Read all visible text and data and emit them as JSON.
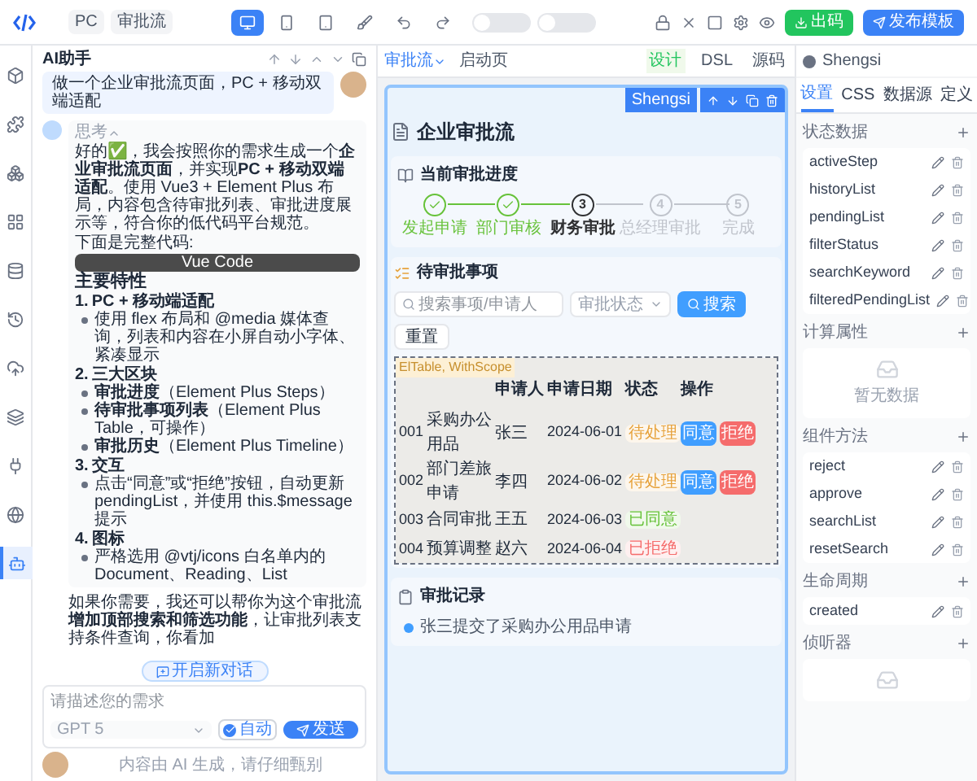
{
  "topbar": {
    "breadcrumbs": [
      "PC",
      "审批流"
    ],
    "toolbar": [
      {
        "selected": true
      },
      {
        "selected": false
      },
      {
        "selected": false
      },
      {
        "selected": false
      },
      {
        "selected": false
      },
      {
        "selected": false
      }
    ],
    "toggles": [
      {
        "on": false
      },
      {
        "on": false
      }
    ],
    "export_button": "出码",
    "publish_button": "发布模板"
  },
  "rail": [
    {
      "selected": false
    },
    {
      "selected": false
    },
    {
      "selected": false
    },
    {
      "selected": false
    },
    {
      "selected": false
    },
    {
      "selected": false
    },
    {
      "selected": false
    },
    {
      "selected": false
    },
    {
      "selected": false
    },
    {
      "selected": false
    },
    {
      "selected": true
    }
  ],
  "assistant": {
    "title": "AI助手",
    "user_message": "做一个企业审批流页面，PC + 移动双端适配",
    "thinking": {
      "label": "思考",
      "expanded": true
    },
    "intro": "好的✅，我会按照你的需求生成一个**企业审批流页面**，并实现**PC + 移动双端适配**。使用 Vue3 + Element Plus 布局，内容包含待审批列表、审批进度展示等，符合你的低代码平台规范。",
    "intro_tail": "下面是完整代码:",
    "code_label": "Vue Code",
    "features_title": "主要特性",
    "features": [
      {
        "number": "1.",
        "title": "PC + 移动端适配",
        "points": [
          "使用 flex 布局和 @media 媒体查询，列表和内容在小屏自动小字体、紧凑显示"
        ]
      },
      {
        "number": "2.",
        "title": "三大区块",
        "points": [
          "**审批进度**（Element Plus Steps）",
          "**待审批事项列表**（Element Plus Table，可操作）",
          "**审批历史**（Element Plus Timeline）"
        ]
      },
      {
        "number": "3.",
        "title": "交互",
        "points": [
          "点击“同意”或“拒绝”按钮，自动更新 pendingList，并使用 this.$message 提示"
        ]
      },
      {
        "number": "4.",
        "title": "图标",
        "points": [
          "严格选用 @vtj/icons 白名单内的 Document、Reading、List"
        ]
      }
    ],
    "followup": "如果你需要，我还可以帮你为这个审批流**增加顶部搜索和筛选功能**，让审批列表支持条件查询，你看加",
    "new_chat": "开启新对话",
    "input": {
      "placeholder": "请描述您的需求"
    },
    "model": "GPT 5",
    "auto": {
      "label": "自动",
      "checked": true
    },
    "send": "发送",
    "disclaimer": "内容由 AI 生成，请仔细甄别"
  },
  "canvas": {
    "tabs": [
      {
        "label": "审批流",
        "selected": true
      },
      {
        "label": "启动页",
        "selected": false
      }
    ],
    "modes": [
      {
        "label": "设计",
        "selected": true
      },
      {
        "label": "DSL",
        "selected": false
      },
      {
        "label": "源码",
        "selected": false
      }
    ],
    "selection_badge": "Shengsi",
    "page": {
      "title": "企业审批流",
      "progress": {
        "title": "当前审批进度",
        "steps": [
          {
            "label": "发起申请",
            "kind": "finish"
          },
          {
            "label": "部门审核",
            "kind": "finish"
          },
          {
            "number": "3",
            "label": "财务审批",
            "kind": "process"
          },
          {
            "number": "4",
            "label": "总经理审批",
            "kind": "wait"
          },
          {
            "number": "5",
            "label": "完成",
            "kind": "wait"
          }
        ]
      },
      "pending": {
        "title": "待审批事项",
        "search": {
          "placeholder": "搜索事项/申请人"
        },
        "status_filter": {
          "placeholder": "审批状态"
        },
        "search_button": "搜索",
        "reset_button": "重置",
        "scope_label": "ElTable, WithScope",
        "table": {
          "columns": [
            "申请人",
            "申请日期",
            "状态",
            "操作"
          ],
          "rows": [
            {
              "id": "001",
              "item": "采购办公用品",
              "applicant": "张三",
              "date": "2024-06-01",
              "status": {
                "label": "待处理",
                "kind": "pending"
              },
              "actions": [
                {
                  "label": "同意",
                  "kind": "approve"
                },
                {
                  "label": "拒绝",
                  "kind": "reject"
                }
              ]
            },
            {
              "id": "002",
              "item": "部门差旅申请",
              "applicant": "李四",
              "date": "2024-06-02",
              "status": {
                "label": "待处理",
                "kind": "pending"
              },
              "actions": [
                {
                  "label": "同意",
                  "kind": "approve"
                },
                {
                  "label": "拒绝",
                  "kind": "reject"
                }
              ]
            },
            {
              "id": "003",
              "item": "合同审批",
              "applicant": "王五",
              "date": "2024-06-03",
              "status": {
                "label": "已同意",
                "kind": "approved"
              }
            },
            {
              "id": "004",
              "item": "预算调整",
              "applicant": "赵六",
              "date": "2024-06-04",
              "status": {
                "label": "已拒绝",
                "kind": "rejected"
              }
            }
          ]
        }
      },
      "history": {
        "title": "审批记录",
        "entries": [
          {
            "text": "张三提交了采购办公用品申请"
          }
        ]
      }
    }
  },
  "inspector": {
    "component": "Shengsi",
    "tabs": [
      {
        "label": "设置",
        "selected": true
      },
      {
        "label": "CSS",
        "selected": false
      },
      {
        "label": "数据源",
        "selected": false
      },
      {
        "label": "定义",
        "selected": false
      }
    ],
    "sections": [
      {
        "title": "状态数据",
        "kind": "list",
        "items": [
          "activeStep",
          "historyList",
          "pendingList",
          "filterStatus",
          "searchKeyword",
          "filteredPendingList"
        ]
      },
      {
        "title": "计算属性",
        "kind": "empty",
        "empty_text": "暂无数据"
      },
      {
        "title": "组件方法",
        "kind": "list",
        "items": [
          "reject",
          "approve",
          "searchList",
          "resetSearch"
        ]
      },
      {
        "title": "生命周期",
        "kind": "list",
        "items": [
          "created"
        ]
      },
      {
        "title": "侦听器",
        "kind": "empty"
      }
    ]
  }
}
